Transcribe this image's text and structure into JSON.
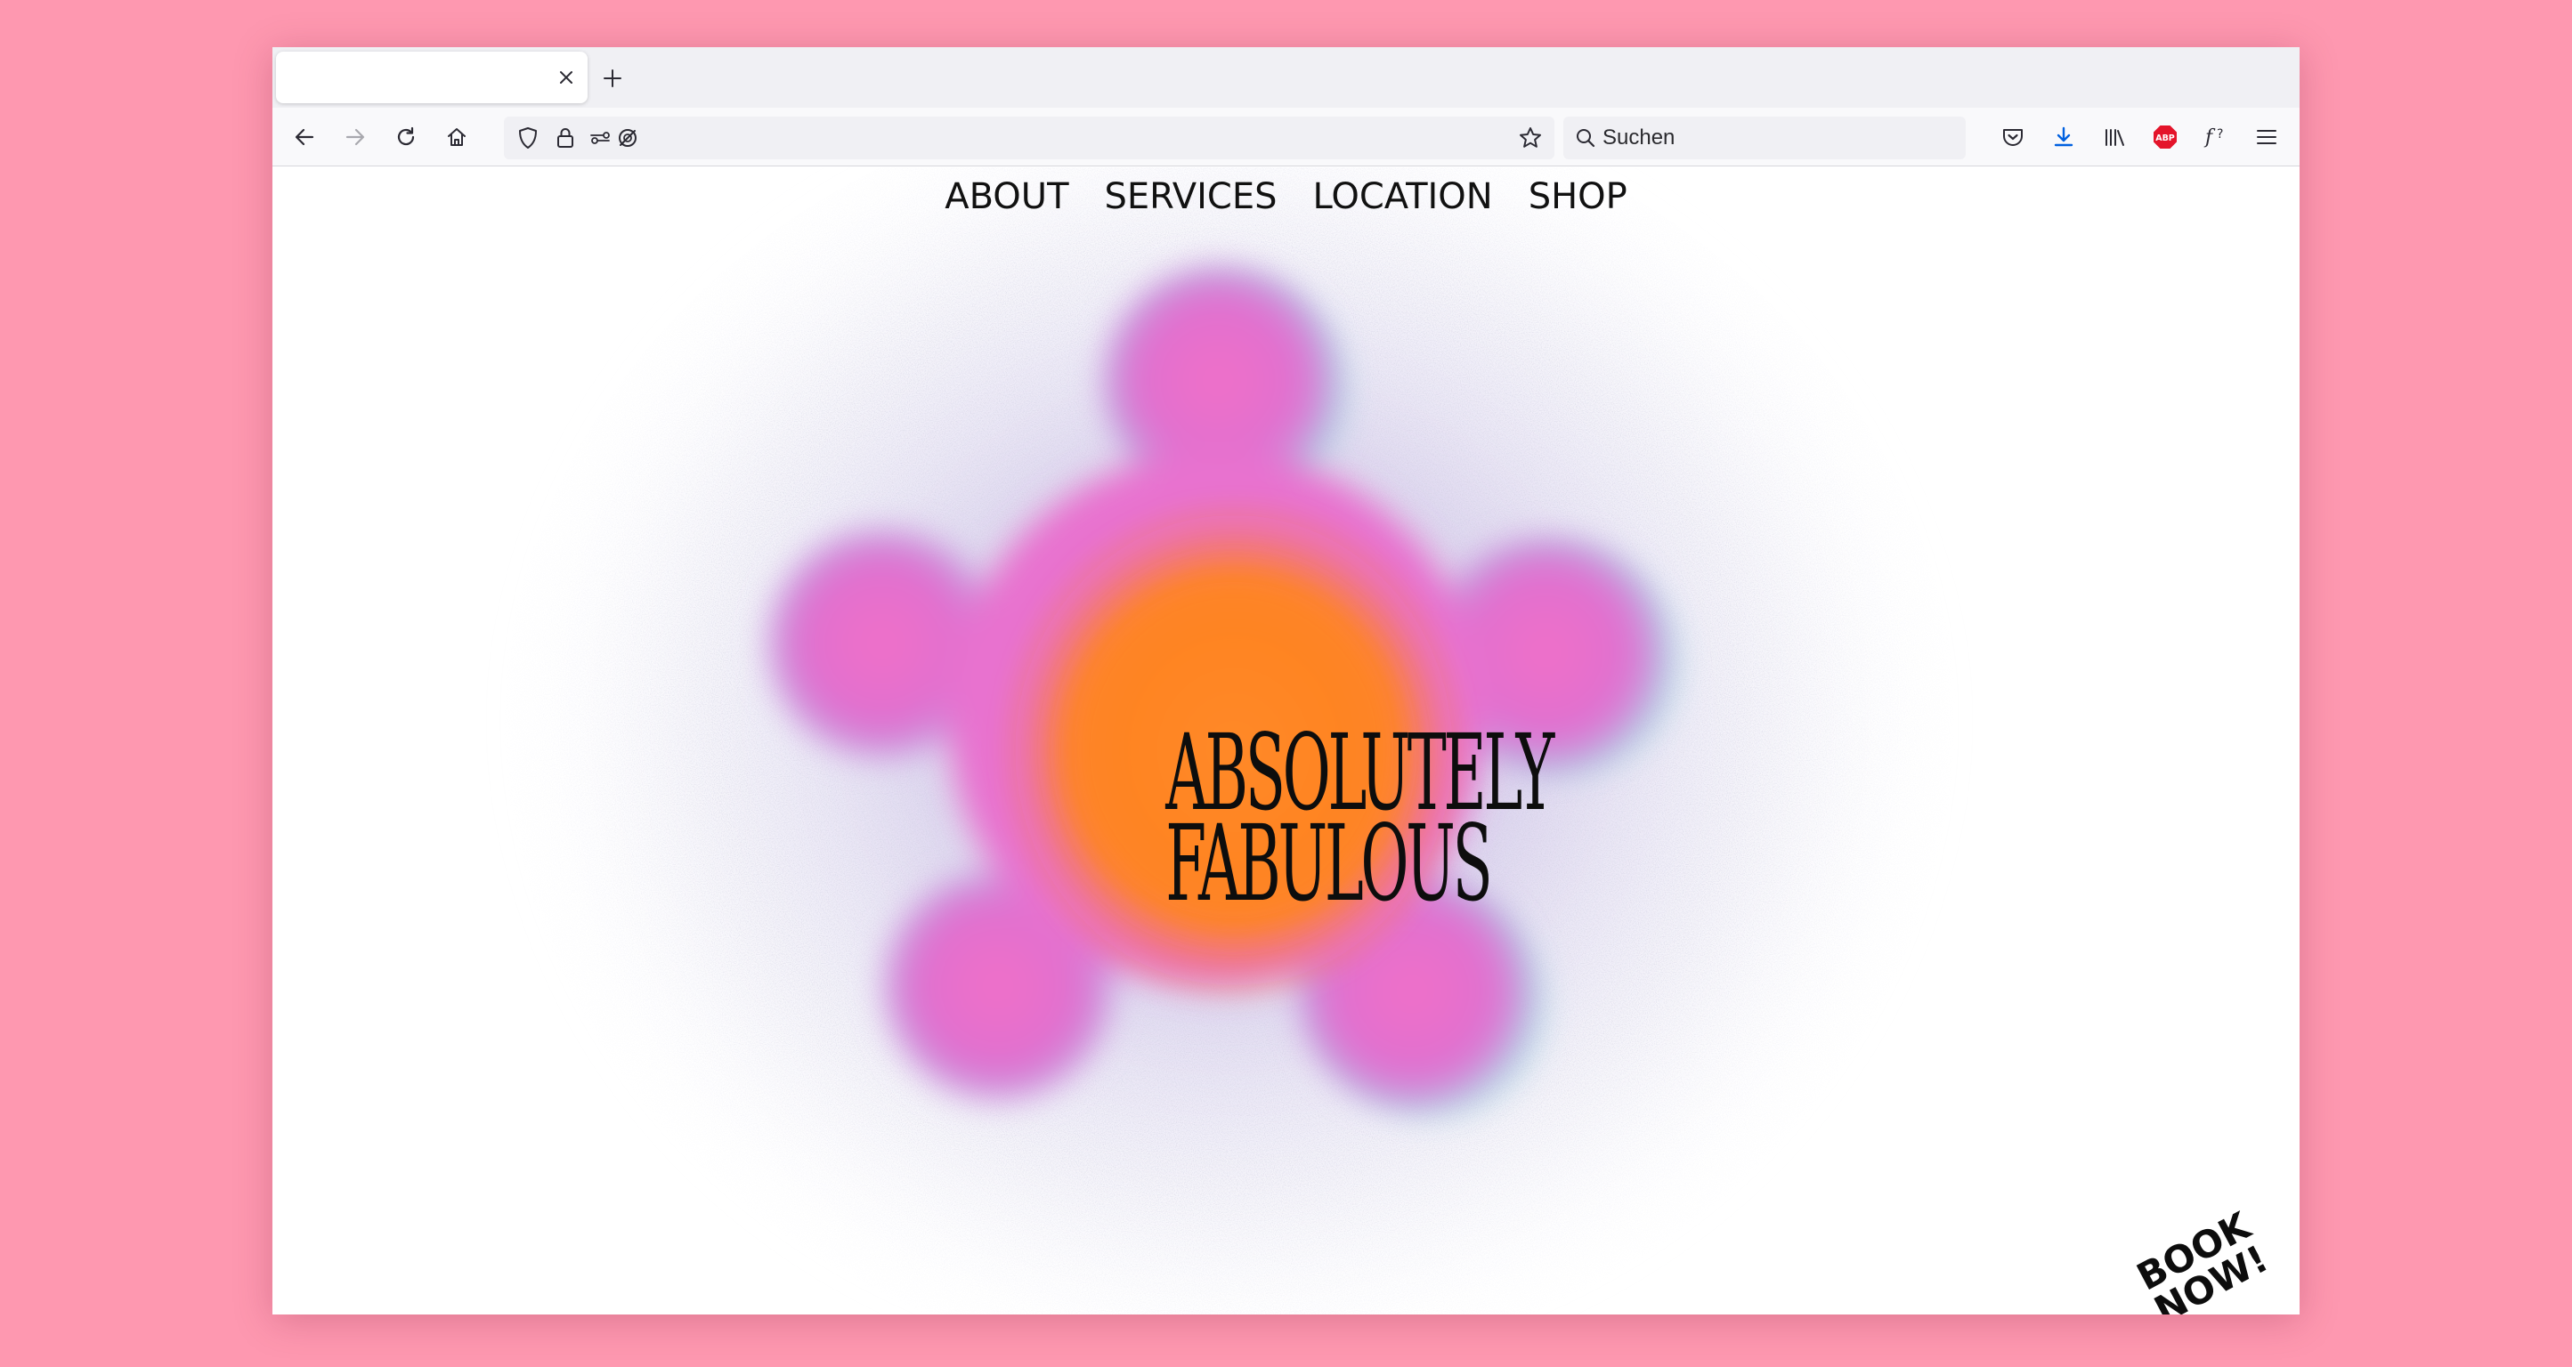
{
  "browser": {
    "tab": {
      "title": ""
    },
    "search": {
      "placeholder": "Suchen"
    }
  },
  "site": {
    "nav": [
      {
        "label": "ABOUT"
      },
      {
        "label": "SERVICES"
      },
      {
        "label": "LOCATION"
      },
      {
        "label": "SHOP"
      }
    ],
    "hero": {
      "line1": "ABSOLUTELY",
      "line2": "FABULOUS"
    },
    "cta": {
      "line1": "BOOK",
      "line2": "NOW!"
    },
    "colors": {
      "background": "#fe98b0",
      "flower_outer": "#e86fd0",
      "flower_inner": "#ff7f1f",
      "halo": "#c9b7e8"
    }
  },
  "icons": [
    "close-icon",
    "plus-icon",
    "back-arrow-icon",
    "forward-arrow-icon",
    "reload-icon",
    "home-icon",
    "shield-icon",
    "lock-icon",
    "permissions-icon",
    "tracking-blocked-icon",
    "bookmark-star-icon",
    "search-icon",
    "pocket-icon",
    "download-icon",
    "library-icon",
    "adblock-plus-icon",
    "font-finder-icon",
    "hamburger-menu-icon"
  ]
}
